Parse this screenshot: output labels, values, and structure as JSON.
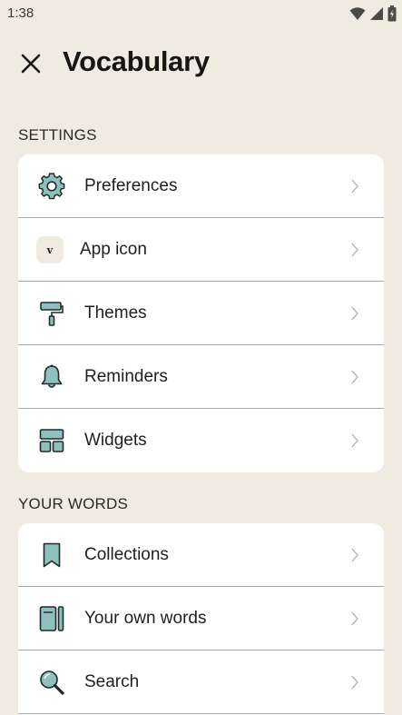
{
  "status_bar": {
    "time": "1:38",
    "icons": [
      "wifi-icon",
      "signal-icon",
      "battery-icon"
    ]
  },
  "header": {
    "close_icon": "close-icon",
    "title": "Vocabulary"
  },
  "settings": {
    "label": "SETTINGS",
    "items": [
      {
        "label": "Preferences",
        "icon": "gear-icon"
      },
      {
        "label": "App icon",
        "icon": "app-icon",
        "icon_letter": "v"
      },
      {
        "label": "Themes",
        "icon": "paint-roller-icon"
      },
      {
        "label": "Reminders",
        "icon": "bell-icon"
      },
      {
        "label": "Widgets",
        "icon": "widgets-icon"
      }
    ]
  },
  "your_words": {
    "label": "YOUR WORDS",
    "items": [
      {
        "label": "Collections",
        "icon": "bookmark-icon"
      },
      {
        "label": "Your own words",
        "icon": "notebook-icon"
      },
      {
        "label": "Search",
        "icon": "magnifier-icon"
      }
    ]
  },
  "colors": {
    "background": "#efebe1",
    "card": "#ffffff",
    "icon_fill": "#8fc0bd",
    "icon_stroke": "#1e2a2a",
    "chevron": "#b5b5b5"
  }
}
